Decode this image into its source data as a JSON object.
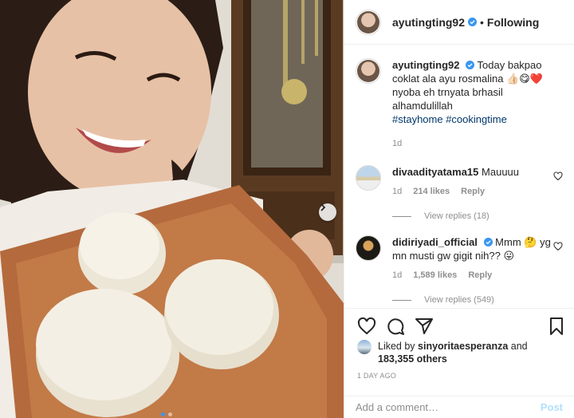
{
  "post": {
    "username": "ayutingting92",
    "follow_status": "Following",
    "separator": "•",
    "caption": {
      "username": "ayutingting92",
      "text": "Today bakpao coklat ala ayu rosmalina 👍🏻😋❤️ nyoba eh trnyata brhasil alhamdulillah",
      "hashtags": "#stayhome #cookingtime",
      "time": "1d"
    }
  },
  "comments": [
    {
      "username": "divaadityatama15",
      "text": "Mauuuu",
      "time": "1d",
      "likes": "214 likes",
      "reply_label": "Reply",
      "view_replies": "View replies (18)"
    },
    {
      "username": "didiriyadi_official",
      "text": "Mmm 🤔 yg mn musti gw gigit nih?? 😛",
      "time": "1d",
      "likes": "1,589 likes",
      "reply_label": "Reply",
      "view_replies": "View replies (549)"
    }
  ],
  "liked_by": {
    "prefix": "Liked by ",
    "user": "sinyoritaesperanza",
    "and": " and ",
    "others": "183,355 others"
  },
  "timestamp": "1 DAY AGO",
  "add_comment": {
    "placeholder": "Add a comment…",
    "post_label": "Post"
  },
  "colors": {
    "verified": "#3897f0",
    "link": "#00376b",
    "muted": "#8e8e8e",
    "post_disabled": "#b2dffc"
  },
  "icons": [
    "heart-icon",
    "comment-icon",
    "share-icon",
    "bookmark-icon",
    "verified-badge-icon",
    "chevron-right-icon"
  ]
}
